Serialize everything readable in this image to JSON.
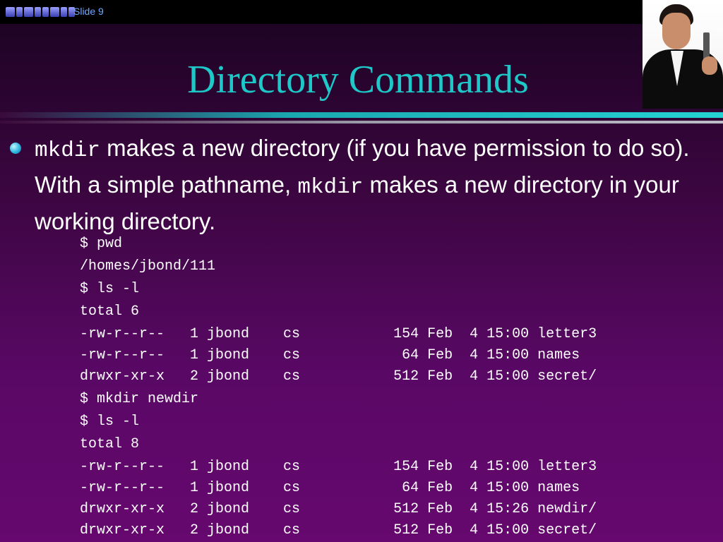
{
  "header": {
    "slide_label": "Slide 9"
  },
  "slide": {
    "title": "Directory Commands",
    "bullet": {
      "cmd1": "mkdir",
      "text1": " makes a new directory (if you have permission to do so). With a simple pathname, ",
      "cmd2": "mkdir",
      "text2": " makes a new directory in your working directory."
    },
    "listing": [
      "$ pwd",
      "/homes/jbond/111",
      "$ ls -l",
      "total 6",
      "-rw-r--r--   1 jbond    cs           154 Feb  4 15:00 letter3",
      "-rw-r--r--   1 jbond    cs            64 Feb  4 15:00 names",
      "drwxr-xr-x   2 jbond    cs           512 Feb  4 15:00 secret/",
      "$ mkdir newdir",
      "$ ls -l",
      "total 8",
      "-rw-r--r--   1 jbond    cs           154 Feb  4 15:00 letter3",
      "-rw-r--r--   1 jbond    cs            64 Feb  4 15:00 names",
      "drwxr-xr-x   2 jbond    cs           512 Feb  4 15:26 newdir/",
      "drwxr-xr-x   2 jbond    cs           512 Feb  4 15:00 secret/"
    ]
  },
  "colors": {
    "title": "#1ec8c8",
    "background_top": "#1a0320",
    "background_bottom": "#66086f",
    "slide_label": "#6fa8ff"
  },
  "icons": {
    "logo": "course-logo-icon",
    "bullet": "bullet-dot-icon",
    "portrait": "agent-portrait-icon"
  }
}
